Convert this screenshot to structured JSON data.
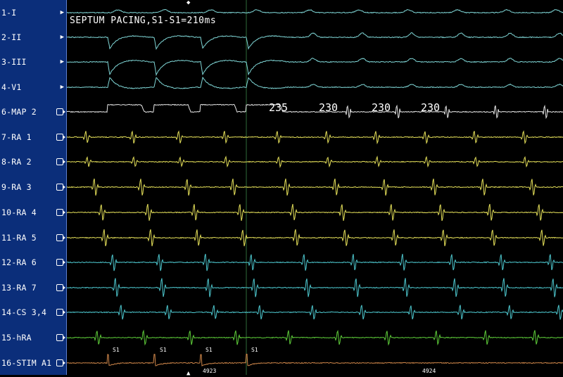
{
  "title_overlay": "SEPTUM PACING,S1-S1=210ms",
  "channels": [
    {
      "label": "1-I",
      "icon": "play-triangle-icon",
      "color": "#7fd6d6"
    },
    {
      "label": "2-II",
      "icon": "play-triangle-icon",
      "color": "#7fd6d6"
    },
    {
      "label": "3-III",
      "icon": "play-triangle-icon",
      "color": "#7fd6d6"
    },
    {
      "label": "4-V1",
      "icon": "play-triangle-icon",
      "color": "#7fd6d6"
    },
    {
      "label": "6-MAP 2",
      "icon": "channel-arrow-icon",
      "color": "#e8e8e8"
    },
    {
      "label": "7-RA 1",
      "icon": "channel-arrow-icon",
      "color": "#e6e15a"
    },
    {
      "label": "8-RA 2",
      "icon": "channel-arrow-icon",
      "color": "#e6e15a"
    },
    {
      "label": "9-RA 3",
      "icon": "channel-arrow-icon",
      "color": "#e6e15a"
    },
    {
      "label": "10-RA 4",
      "icon": "channel-arrow-icon",
      "color": "#e6e15a"
    },
    {
      "label": "11-RA 5",
      "icon": "channel-arrow-icon",
      "color": "#e6e15a"
    },
    {
      "label": "12-RA 6",
      "icon": "channel-arrow-icon",
      "color": "#4ec9d0"
    },
    {
      "label": "13-RA 7",
      "icon": "channel-arrow-icon",
      "color": "#4ec9d0"
    },
    {
      "label": "14-CS 3,4",
      "icon": "channel-arrow-icon",
      "color": "#4ec9d0"
    },
    {
      "label": "15-hRA",
      "icon": "channel-arrow-icon",
      "color": "#5fcf3a"
    },
    {
      "label": "16-STIM A1",
      "icon": "channel-arrow-icon",
      "color": "#d0874a"
    }
  ],
  "intervals": [
    "235",
    "230",
    "230",
    "230"
  ],
  "stim_labels": [
    "S1",
    "S1",
    "S1",
    "S1"
  ],
  "beat_numbers": [
    "4923",
    "4924"
  ],
  "colors": {
    "sidebar": "#0b2e7a",
    "background": "#000000",
    "cursor": "#2f6b3a"
  }
}
